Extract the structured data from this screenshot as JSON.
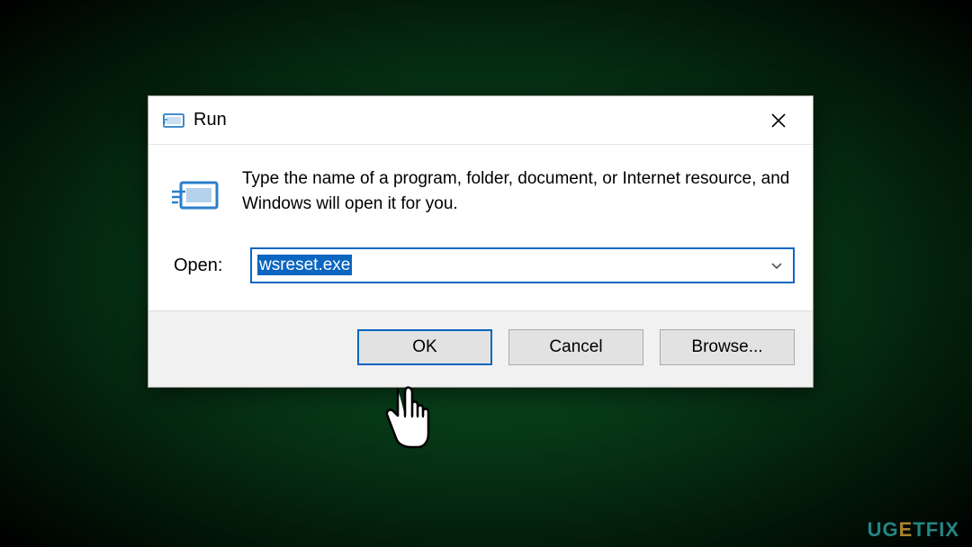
{
  "dialog": {
    "title": "Run",
    "description": "Type the name of a program, folder, document, or Internet resource, and Windows will open it for you.",
    "open_label": "Open:",
    "command_value": "wsreset.exe",
    "buttons": {
      "ok": "OK",
      "cancel": "Cancel",
      "browse": "Browse..."
    }
  },
  "watermark": "UGETFIX"
}
